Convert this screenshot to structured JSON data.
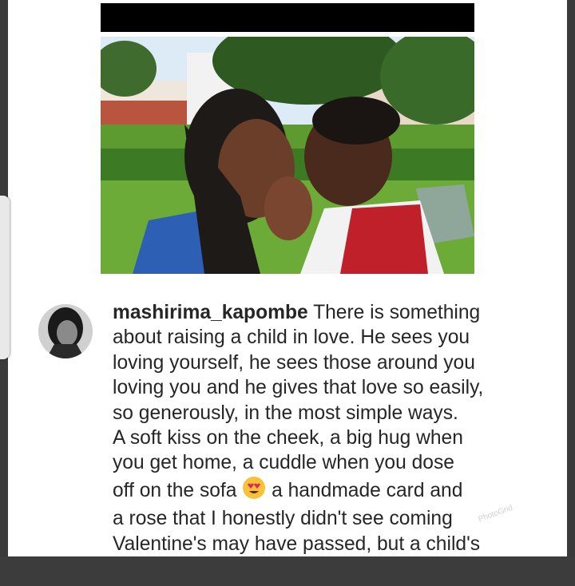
{
  "post": {
    "username": "mashirima_kapombe",
    "caption": " There is something\nabout raising a child in love. He sees you\nloving yourself, he sees those around you\nloving you and he gives that love so easily,\nso generously, in the most simple ways.\nA soft kiss on the cheek, a big hug when\nyou get home, a cuddle when you dose\noff on the sofa ",
    "caption_after_emoji": " a handmade card and\na rose that I honestly didn't see coming\nValentine's may have passed, but a child's",
    "emoji_icon": "heart-eyes-emoji",
    "watermark": "PhotoGrid"
  },
  "colors": {
    "background": "#3a3a3a",
    "card": "#ffffff",
    "text": "#262626"
  }
}
